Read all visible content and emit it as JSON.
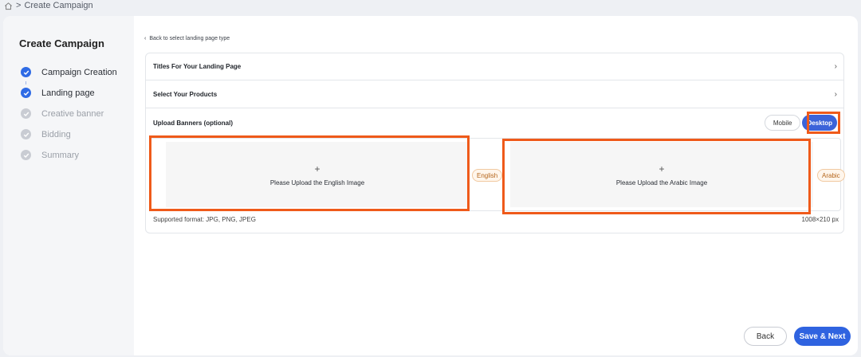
{
  "breadcrumb": {
    "separator": ">",
    "current": "Create Campaign"
  },
  "sidebar": {
    "title": "Create Campaign",
    "steps": [
      {
        "label": "Campaign Creation",
        "status": "done"
      },
      {
        "label": "Landing page",
        "status": "done"
      },
      {
        "label": "Creative banner",
        "status": "pending"
      },
      {
        "label": "Bidding",
        "status": "pending"
      },
      {
        "label": "Summary",
        "status": "pending"
      }
    ]
  },
  "main": {
    "back_link": "Back to select landing page type",
    "sections": [
      {
        "title": "Titles For Your Landing Page"
      },
      {
        "title": "Select Your Products"
      }
    ],
    "upload": {
      "title": "Upload Banners (optional)",
      "toggle": {
        "mobile": "Mobile",
        "desktop": "Desktop",
        "selected": "Desktop"
      },
      "english": {
        "plus": "+",
        "text": "Please Upload the English Image",
        "tag": "English"
      },
      "arabic": {
        "plus": "+",
        "text": "Please Upload the Arabic Image",
        "tag": "Arabic"
      },
      "supported": "Supported format: JPG, PNG, JPEG",
      "size": "1008×210 px"
    }
  },
  "actions": {
    "back": "Back",
    "save_next": "Save & Next"
  },
  "colors": {
    "primary": "#2f63e0",
    "highlight": "#ef5a1a",
    "tag_text": "#b4651a"
  }
}
